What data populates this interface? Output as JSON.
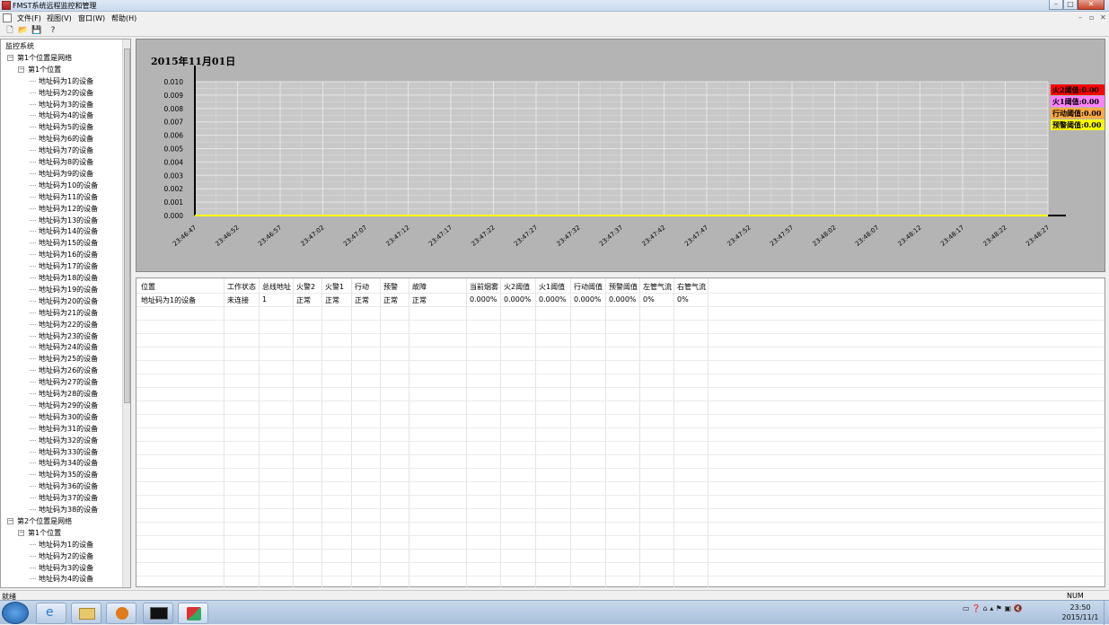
{
  "window": {
    "title": "FMST系统远程监控和管理",
    "minimize": "–",
    "maximize": "□",
    "close": "✕"
  },
  "menu": {
    "items": [
      "文件(F)",
      "视图(V)",
      "窗口(W)",
      "帮助(H)"
    ],
    "mdi_controls": [
      "–",
      "▫",
      "✕"
    ]
  },
  "toolbar": {
    "icons": [
      "new-document-icon",
      "open-folder-icon",
      "save-icon",
      "help-icon"
    ],
    "glyphs": [
      "🗋",
      "📂",
      "💾",
      "?"
    ]
  },
  "tree": {
    "root": "监控系统",
    "networks": [
      {
        "label": "第1个位置是网络",
        "location": "第1个位置",
        "devices": [
          "地址码为1的设备",
          "地址码为2的设备",
          "地址码为3的设备",
          "地址码为4的设备",
          "地址码为5的设备",
          "地址码为6的设备",
          "地址码为7的设备",
          "地址码为8的设备",
          "地址码为9的设备",
          "地址码为10的设备",
          "地址码为11的设备",
          "地址码为12的设备",
          "地址码为13的设备",
          "地址码为14的设备",
          "地址码为15的设备",
          "地址码为16的设备",
          "地址码为17的设备",
          "地址码为18的设备",
          "地址码为19的设备",
          "地址码为20的设备",
          "地址码为21的设备",
          "地址码为22的设备",
          "地址码为23的设备",
          "地址码为24的设备",
          "地址码为25的设备",
          "地址码为26的设备",
          "地址码为27的设备",
          "地址码为28的设备",
          "地址码为29的设备",
          "地址码为30的设备",
          "地址码为31的设备",
          "地址码为32的设备",
          "地址码为33的设备",
          "地址码为34的设备",
          "地址码为35的设备",
          "地址码为36的设备",
          "地址码为37的设备",
          "地址码为38的设备"
        ]
      },
      {
        "label": "第2个位置是网络",
        "location": "第1个位置",
        "devices": [
          "地址码为1的设备",
          "地址码为2的设备",
          "地址码为3的设备",
          "地址码为4的设备"
        ]
      }
    ]
  },
  "chart_data": {
    "type": "line",
    "title": "2015年11月01日",
    "y_ticks": [
      "0.010",
      "0.009",
      "0.008",
      "0.007",
      "0.006",
      "0.005",
      "0.004",
      "0.003",
      "0.002",
      "0.001",
      "0.000"
    ],
    "ylim": [
      0,
      0.01
    ],
    "x_ticks": [
      "23:46:47",
      "23:46:52",
      "23:46:57",
      "23:47:02",
      "23:47:07",
      "23:47:12",
      "23:47:17",
      "23:47:22",
      "23:47:27",
      "23:47:32",
      "23:47:37",
      "23:47:42",
      "23:47:47",
      "23:47:52",
      "23:47:57",
      "23:48:02",
      "23:48:07",
      "23:48:12",
      "23:48:17",
      "23:48:22",
      "23:48:27"
    ],
    "series": [
      {
        "values": [
          0,
          0,
          0,
          0,
          0,
          0,
          0,
          0,
          0,
          0,
          0,
          0,
          0,
          0,
          0,
          0,
          0,
          0,
          0,
          0,
          0
        ],
        "color": "#ffff00"
      }
    ],
    "grid": true,
    "legend_position": "right",
    "legend": [
      {
        "label": "火2阈值:0.00",
        "bg": "#ff0000",
        "fg": "#000000"
      },
      {
        "label": "火1阈值:0.00",
        "bg": "#ff80ff",
        "fg": "#000000"
      },
      {
        "label": "行动阈值:0.00",
        "bg": "#ffaa44",
        "fg": "#000000"
      },
      {
        "label": "预警阈值:0.00",
        "bg": "#ffff00",
        "fg": "#000000"
      }
    ]
  },
  "table": {
    "columns": [
      "位置",
      "工作状态",
      "总线地址",
      "火警2",
      "火警1",
      "行动",
      "预警",
      "故障",
      "当前烟雾",
      "火2阈值",
      "火1阈值",
      "行动阈值",
      "预警阈值",
      "左管气流",
      "右管气流"
    ],
    "rows": [
      [
        "地址码为1的设备",
        "未连接",
        "1",
        "正常",
        "正常",
        "正常",
        "正常",
        "正常",
        "0.000%",
        "0.000%",
        "0.000%",
        "0.000%",
        "0.000%",
        "0%",
        "0%"
      ]
    ]
  },
  "status": {
    "left": "就绪",
    "right": "NUM"
  },
  "taskbar": {
    "apps": [
      "internet-explorer-icon",
      "file-explorer-icon",
      "media-player-icon",
      "command-prompt-icon",
      "fmst-app-icon"
    ],
    "tray": "▭ ❓ ⌂ ▴ ⚑ ▣ 🔇",
    "time": "23:50",
    "date": "2015/11/1"
  }
}
